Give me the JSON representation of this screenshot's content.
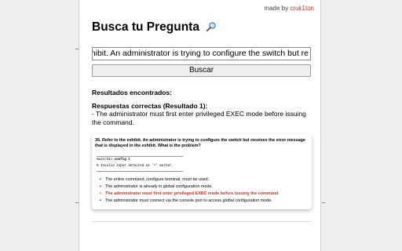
{
  "made_by": {
    "prefix": "made by",
    "author": "cruk1ton"
  },
  "title": "Busca tu Pregunta",
  "search": {
    "value": "o the exhibit. An administrator is trying to configure the switch but re",
    "button_label": "Buscar"
  },
  "results": {
    "heading": "Resultados encontrados:",
    "answers_heading": "Respuestas correctas (Resultado 1):",
    "answer": "- The administrator must first enter privileged EXEC mode before issuing the command."
  },
  "question_card": {
    "question": "35. Refer to the exhibit. An administrator is trying to configure the switch but receives the error message that is displayed in the exhibit. What is the problem?",
    "cli_prompt": "Switch1>",
    "cli_command": "config t",
    "cli_error": "% Invalid input detected at '^' marker.",
    "options": [
      {
        "text": "The entire command, configure terminal, must be used.",
        "correct": false
      },
      {
        "text": "The administrator is already in global configuration mode.",
        "correct": false
      },
      {
        "text": "The administrator must first enter privileged EXEC mode before issuing the command.",
        "correct": true
      },
      {
        "text": "The administrator must connect via the console port to access global configuration mode.",
        "correct": false
      }
    ]
  },
  "colors": {
    "accent": "#d62e1f",
    "author_link": "#c0392b",
    "button_bg": "#efefef",
    "backdrop": "#efefef"
  },
  "icons": {
    "title_icon": "magnifying-glass-icon"
  }
}
